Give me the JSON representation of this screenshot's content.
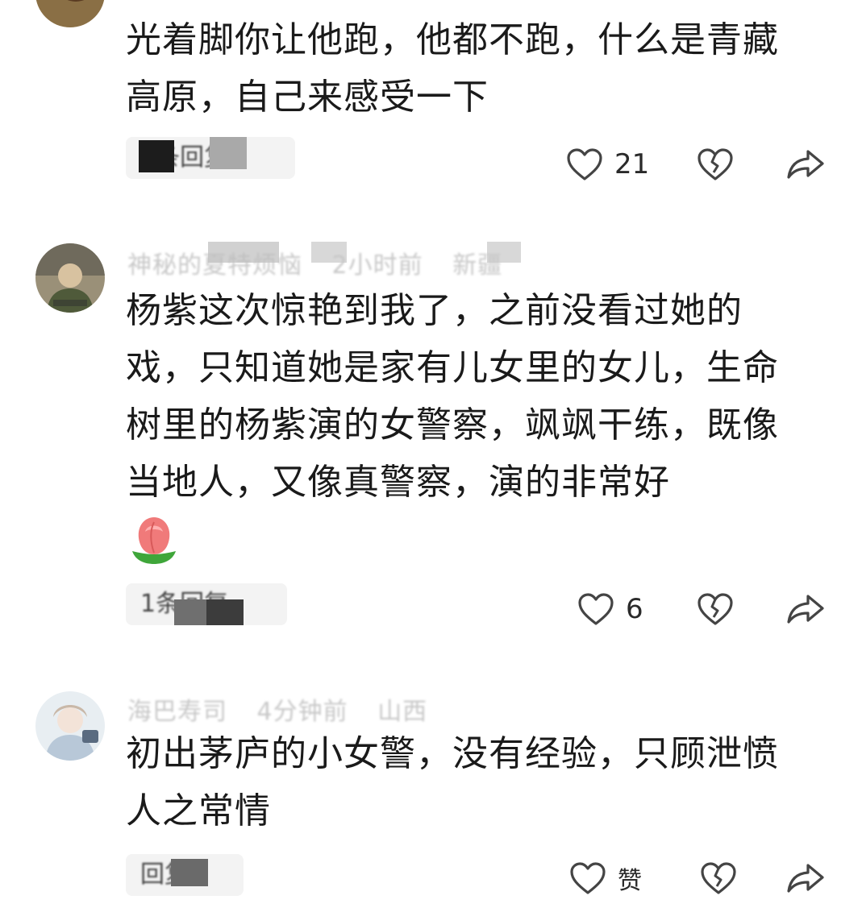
{
  "comments": [
    {
      "text": "光着脚你让他跑，他都不跑，什么是青藏高原，自己来感受一下",
      "reply_label": "1条回复",
      "likes": "21"
    },
    {
      "username": "神秘的夏特烦恼",
      "time": "2小时前",
      "location": "新疆",
      "text": "杨紫这次惊艳到我了，之前没看过她的戏，只知道她是家有儿女里的女儿，生命树里的杨紫演的女警察，飒飒干练，既像当地人，又像真警察，演的非常好",
      "reply_label": "1条回复",
      "likes": "6"
    },
    {
      "username": "海巴寿司",
      "time": "4分钟前",
      "location": "山西",
      "text": "初出茅庐的小女警，没有经验，只顾泄愤人之常情",
      "reply_label": "回复",
      "likes": "赞"
    }
  ],
  "icons": {
    "like": "heart-outline-icon",
    "dislike": "broken-heart-icon",
    "share": "share-arrow-icon",
    "emoji": "rose-emoji-icon"
  },
  "colors": {
    "text": "#1a1a1a",
    "meta": "#b5b5b5",
    "pill": "#f3f3f3",
    "icon": "#444444"
  }
}
